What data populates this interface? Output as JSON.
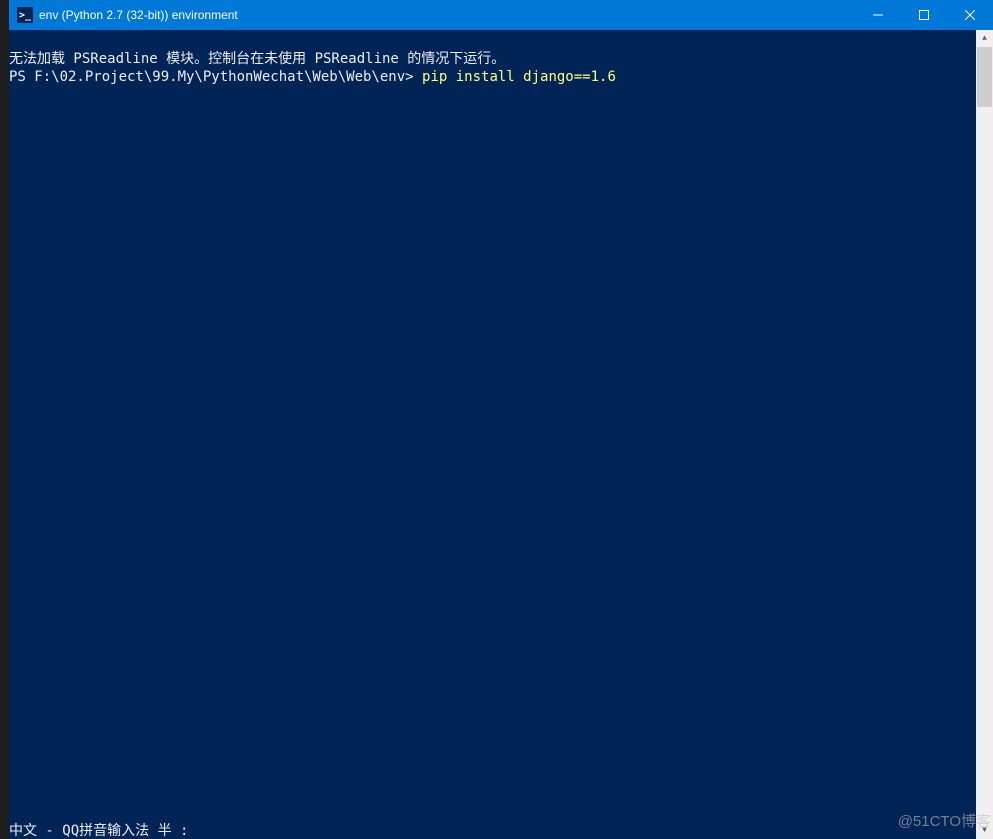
{
  "titlebar": {
    "icon_glyph": ">_",
    "title": "env (Python 2.7 (32-bit)) environment"
  },
  "terminal": {
    "line1": "无法加载 PSReadline 模块。控制台在未使用 PSReadline 的情况下运行。",
    "prompt": "PS F:\\02.Project\\99.My\\PythonWechat\\Web\\Web\\env> ",
    "command": "pip install django==1.6"
  },
  "ime": {
    "status": "中文 - QQ拼音输入法 半 :"
  },
  "watermark": "@51CTO博客"
}
